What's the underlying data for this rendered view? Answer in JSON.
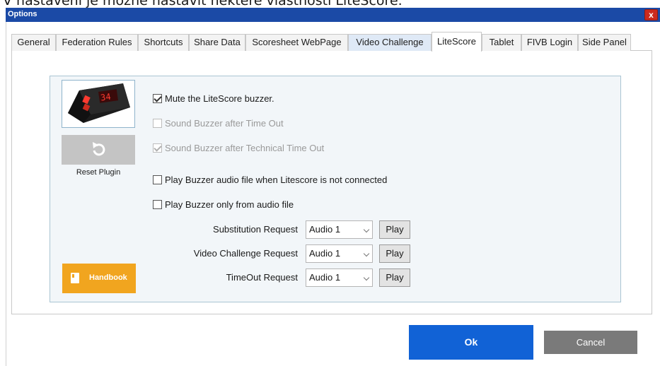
{
  "document": {
    "caption": "V nastavení je možné nastavit některé vlastnosti LiteScore."
  },
  "window": {
    "title": "Options",
    "close_glyph": "x"
  },
  "tabs": [
    {
      "label": "General"
    },
    {
      "label": "Federation Rules"
    },
    {
      "label": "Shortcuts"
    },
    {
      "label": "Share Data"
    },
    {
      "label": "Scoresheet WebPage"
    },
    {
      "label": "Video Challenge"
    },
    {
      "label": "LiteScore"
    },
    {
      "label": "Tablet"
    },
    {
      "label": "FIVB Login"
    },
    {
      "label": "Side Panel"
    }
  ],
  "active_tab": "LiteScore",
  "device": {
    "display_text": "34"
  },
  "plugin": {
    "reset_icon": "refresh-icon",
    "reset_label": "Reset Plugin"
  },
  "options": [
    {
      "label": "Mute the LiteScore buzzer.",
      "checked": true,
      "enabled": true
    },
    {
      "label": "Sound Buzzer after Time Out",
      "checked": false,
      "enabled": false
    },
    {
      "label": "Sound Buzzer after Technical Time Out",
      "checked": true,
      "enabled": false
    },
    {
      "label": "Play Buzzer audio file when Litescore is not connected",
      "checked": false,
      "enabled": true
    },
    {
      "label": "Play Buzzer only from audio file",
      "checked": false,
      "enabled": true
    }
  ],
  "audio_requests": [
    {
      "label": "Substitution Request",
      "value": "Audio 1",
      "play_label": "Play"
    },
    {
      "label": "Video Challenge Request",
      "value": "Audio 1",
      "play_label": "Play"
    },
    {
      "label": "TimeOut Request",
      "value": "Audio 1",
      "play_label": "Play"
    }
  ],
  "handbook": {
    "label": "Handbook",
    "icon": "book-icon"
  },
  "footer": {
    "ok_label": "Ok",
    "cancel_label": "Cancel"
  },
  "colors": {
    "titlebar": "#1b4aa6",
    "ok_button": "#1162d6",
    "handbook_button": "#f1a51f",
    "cancel_button": "#7a7a7a",
    "close_button": "#cc2a1e"
  }
}
